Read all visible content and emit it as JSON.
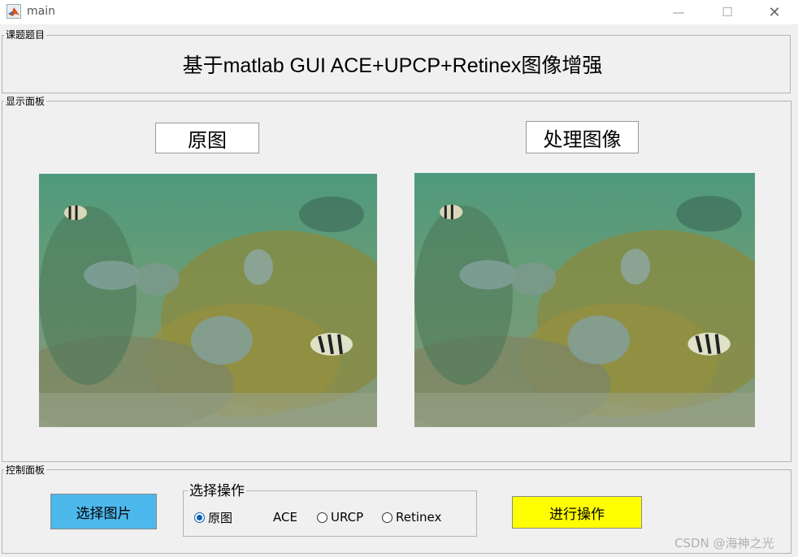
{
  "window": {
    "title": "main",
    "minimize": "—",
    "maximize": "☐",
    "close": "✕"
  },
  "title_panel": {
    "label": "课题题目",
    "course_title": "基于matlab GUI ACE+UPCP+Retinex图像增强"
  },
  "display_panel": {
    "label": "显示面板",
    "original_caption": "原图",
    "processed_caption": "处理图像"
  },
  "control_panel": {
    "label": "控制面板",
    "select_image_button": "选择图片",
    "operation_group": {
      "label": "选择操作",
      "options": [
        {
          "label": "原图",
          "selected": true
        },
        {
          "label": "ACE",
          "selected": false
        },
        {
          "label": "URCP",
          "selected": false
        },
        {
          "label": "Retinex",
          "selected": false
        }
      ]
    },
    "run_button": "进行操作"
  },
  "watermark": "CSDN @海神之光",
  "colors": {
    "select_button": "#4db8ec",
    "run_button": "#ffff00",
    "radio_selected": "#0b5fb5",
    "panel_bg": "#f0f0f0"
  },
  "icons": {
    "app": "matlab-logo-icon"
  }
}
